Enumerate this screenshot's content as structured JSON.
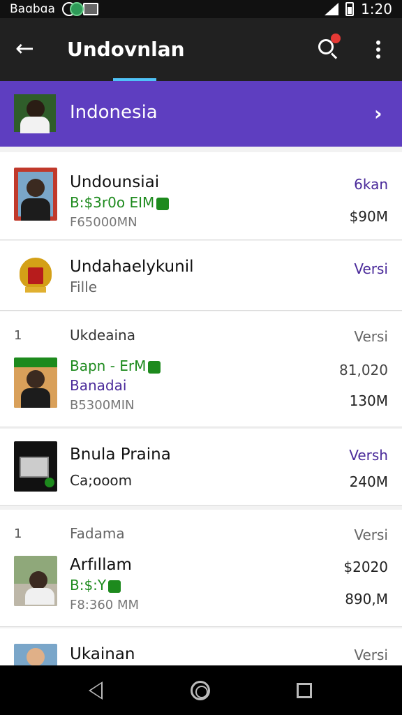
{
  "status_bar": {
    "carrier": "Baɑbɑa",
    "time": "1:20"
  },
  "app_bar": {
    "title": "Undovnlan"
  },
  "banner": {
    "title": "Indonesia"
  },
  "items": [
    {
      "title": "Undounsiai",
      "line2": "B:$3r0o EIM",
      "line3": "F65000MN",
      "right_top": "6kan",
      "right_value": "$90M"
    },
    {
      "title": "Undahaelykunil",
      "line2": "Fille",
      "right_top": "Versi"
    },
    {
      "index": "1",
      "header": "Ukdeaina",
      "header_right": "Versi",
      "line2": "Bapn - ErM",
      "line3": "Banadai",
      "line4": "B5300MIN",
      "right_value_1": "81,020",
      "right_value_2": "130M"
    },
    {
      "title": "Bnula Praina",
      "line2": "Ca;ooom",
      "right_top": "Versh",
      "right_value": "240M"
    },
    {
      "index": "1",
      "header": "Fadama",
      "header_right": "Versi",
      "title": "Arfıllam",
      "line2": "B:$:Y",
      "line3": "F8:360 MM",
      "right_value_1": "$2020",
      "right_value_2": "890,M"
    },
    {
      "title": "Ukainan",
      "right_top": "Versi"
    }
  ],
  "colors": {
    "app_bar": "#212121",
    "banner": "#5e3ec0",
    "accent_green": "#1d8a1d",
    "accent_purple": "#4a2a9a"
  }
}
